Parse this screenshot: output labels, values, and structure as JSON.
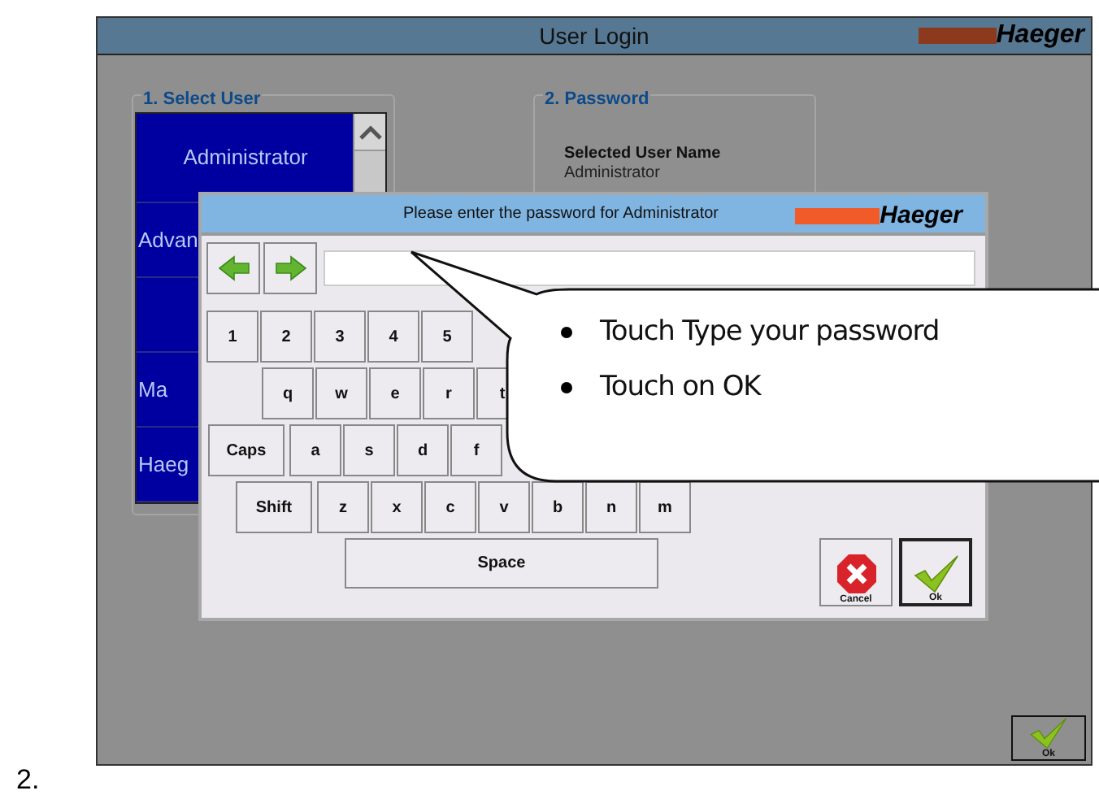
{
  "screen": {
    "title": "User Login",
    "logo": "Haeger",
    "select_user": {
      "legend": "1. Select User",
      "users": [
        {
          "label": "Administrator",
          "kind": "full"
        },
        {
          "label": "Advan",
          "kind": "covered"
        },
        {
          "kind": "covered"
        },
        {
          "label": "Ma",
          "kind": "covered"
        },
        {
          "label": "Haeg",
          "kind": "covered"
        }
      ]
    },
    "password": {
      "legend": "2. Password",
      "selected_user_label": "Selected User Name",
      "selected_user": "Administrator"
    },
    "ok_button": "Ok"
  },
  "dialog": {
    "title": "Please enter the password for Administrator",
    "logo": "Haeger",
    "keyboard": {
      "rows": [
        {
          "keys": [
            "1",
            "2",
            "3",
            "4",
            "5"
          ]
        },
        {
          "keys": [
            "q",
            "w",
            "e",
            "r",
            "t"
          ]
        },
        {
          "keys": [
            "Caps",
            "a",
            "s",
            "d",
            "f"
          ]
        },
        {
          "keys": [
            "Shift",
            "z",
            "x",
            "c",
            "v",
            "b",
            "n",
            "m"
          ]
        }
      ],
      "space": "Space"
    },
    "cancel_button": "Cancel",
    "ok_button": "Ok"
  },
  "callout": {
    "items": [
      "Touch Type your password",
      "Touch on OK"
    ]
  },
  "list_number": "2."
}
